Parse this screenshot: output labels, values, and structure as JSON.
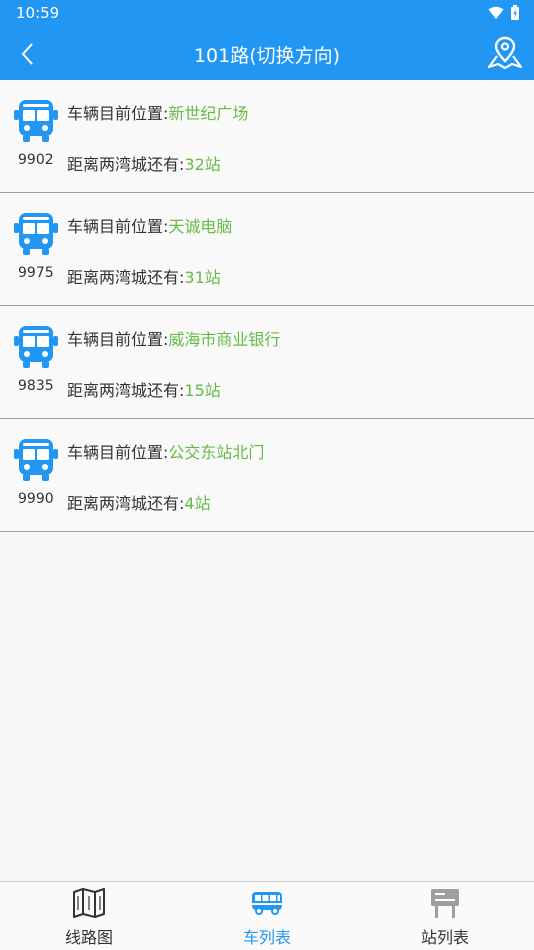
{
  "status": {
    "time": "10:59"
  },
  "header": {
    "title": "101路(切换方向)"
  },
  "vehicles": [
    {
      "plate": "9902",
      "pos_label": "车辆目前位置:",
      "pos_value": "新世纪广场",
      "dist_label": "距离两湾城还有:",
      "dist_value": "32站"
    },
    {
      "plate": "9975",
      "pos_label": "车辆目前位置:",
      "pos_value": "天诚电脑",
      "dist_label": "距离两湾城还有:",
      "dist_value": "31站"
    },
    {
      "plate": "9835",
      "pos_label": "车辆目前位置:",
      "pos_value": "威海市商业银行",
      "dist_label": "距离两湾城还有:",
      "dist_value": "15站"
    },
    {
      "plate": "9990",
      "pos_label": "车辆目前位置:",
      "pos_value": "公交东站北门",
      "dist_label": "距离两湾城还有:",
      "dist_value": "4站"
    }
  ],
  "tabs": [
    {
      "label": "线路图",
      "icon": "map-book-icon",
      "active": false
    },
    {
      "label": "车列表",
      "icon": "bus-icon",
      "active": true
    },
    {
      "label": "站列表",
      "icon": "station-sign-icon",
      "active": false
    }
  ],
  "colors": {
    "primary": "#2196f3",
    "highlight": "#66bb47"
  }
}
